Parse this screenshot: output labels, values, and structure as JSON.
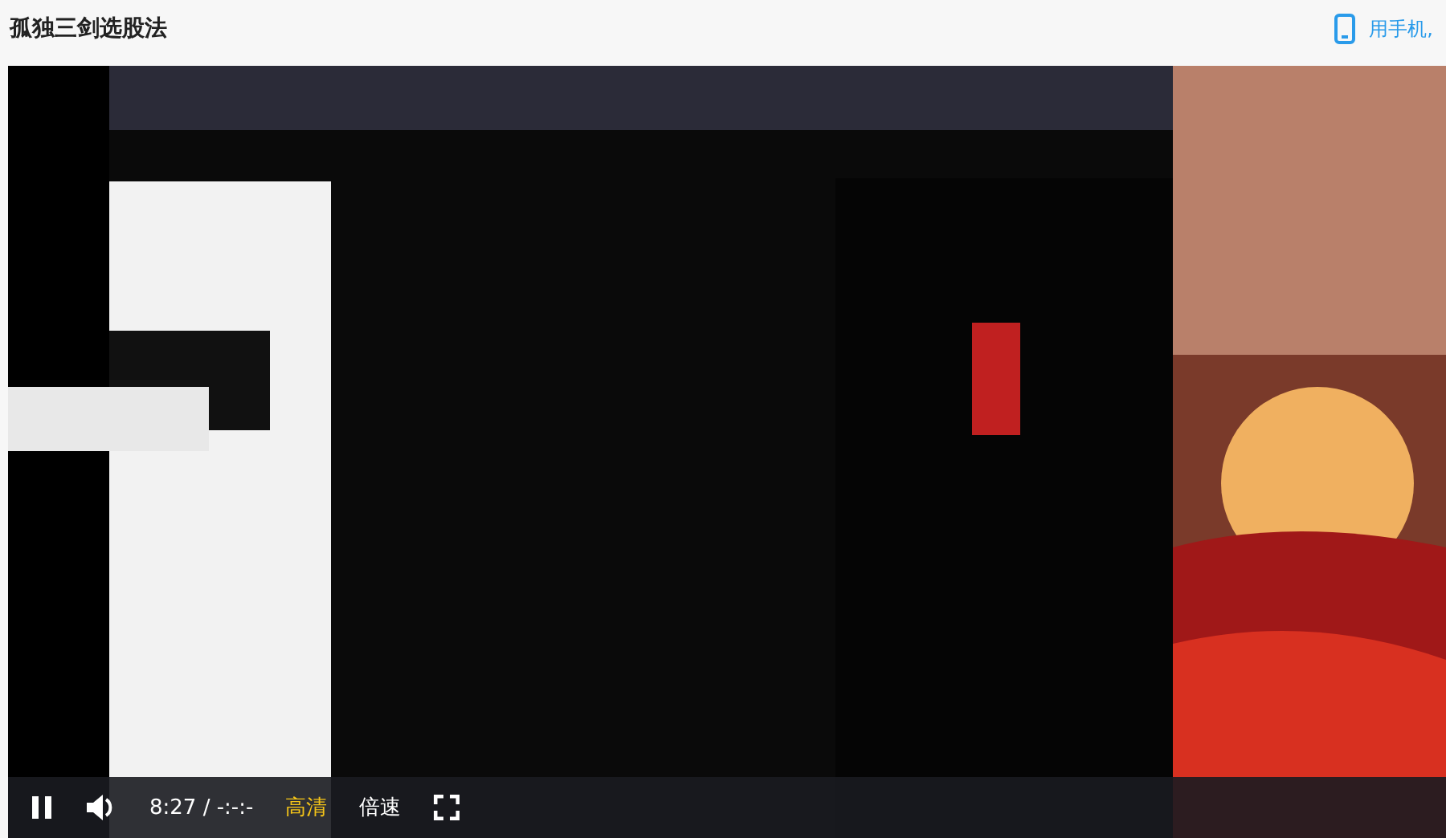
{
  "page_title": "孤独三剑选股法",
  "mobile_link": "用手机,",
  "player": {
    "playing": true,
    "time": "8:27 / -:-:-",
    "quality": "高清",
    "speed": "倍速"
  }
}
